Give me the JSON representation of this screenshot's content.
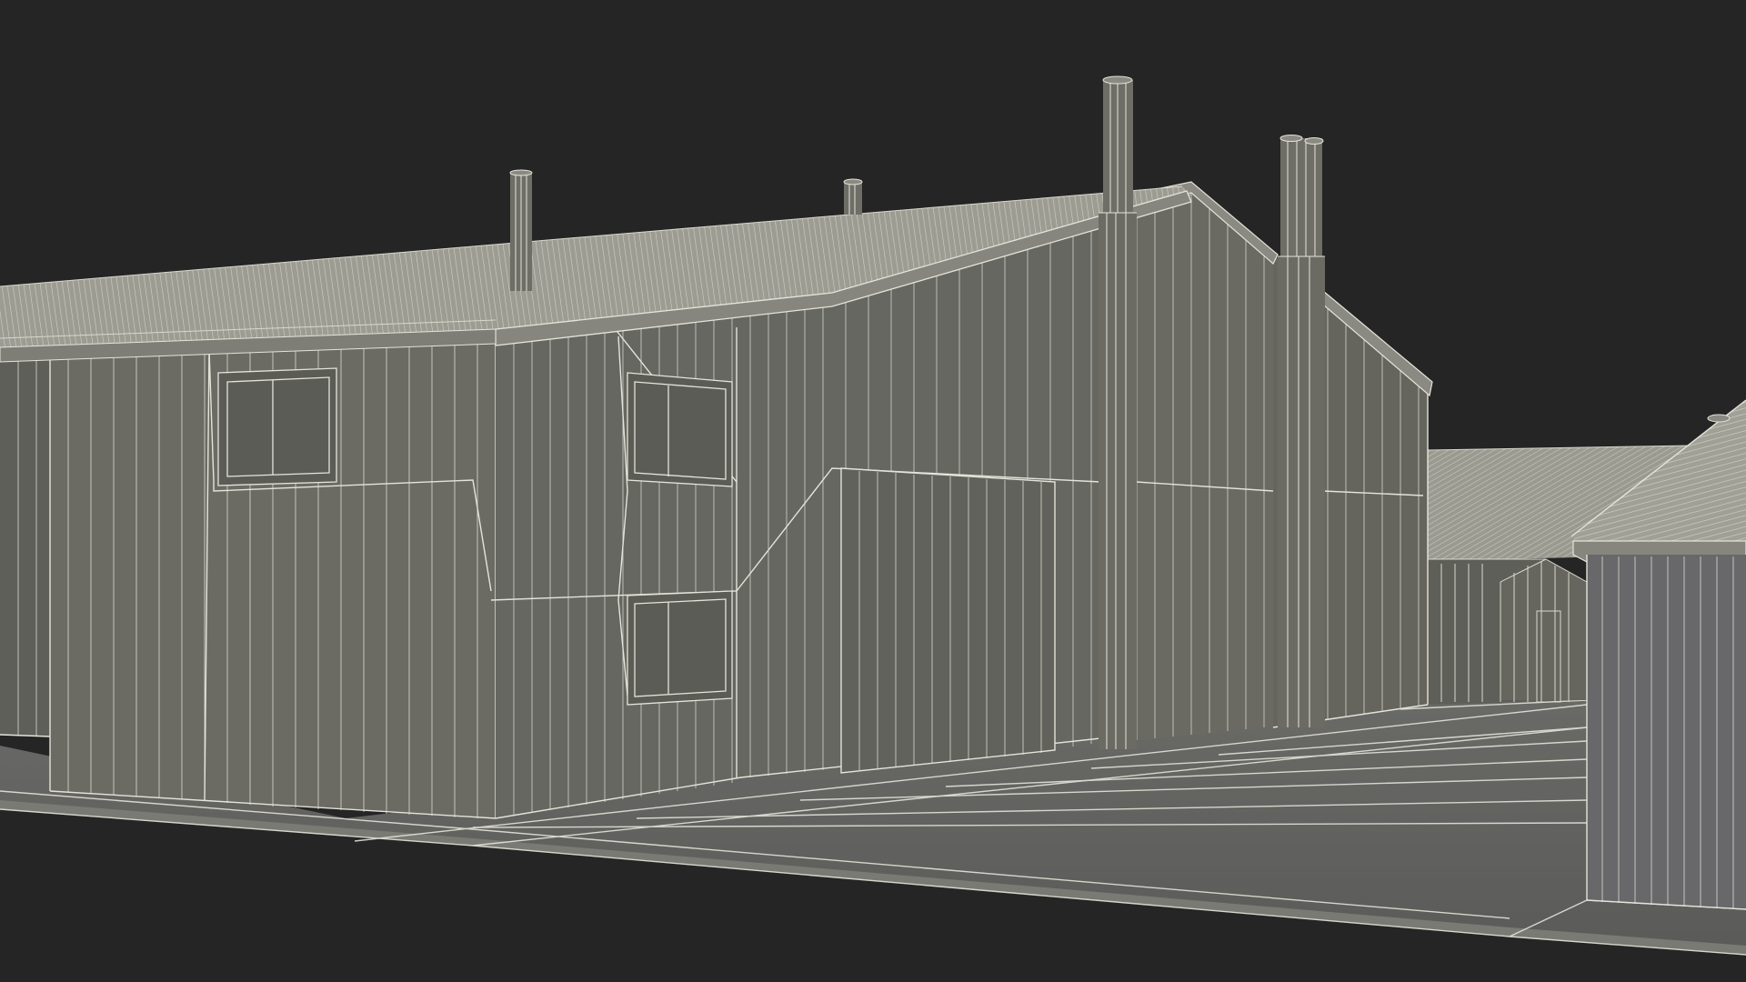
{
  "scene": {
    "subject": "corrugated-metal-warehouse-buildings",
    "render_style": "wireframe-over-clay",
    "colors": {
      "background": "#252525",
      "wall": "#6a6a63",
      "wall_shadow": "#5c5c56",
      "roof": "#9a9a90",
      "roof_light": "#b9b9ae",
      "ground": "#626260",
      "wire": "#e4e4da",
      "window": "#5e5e58"
    }
  }
}
